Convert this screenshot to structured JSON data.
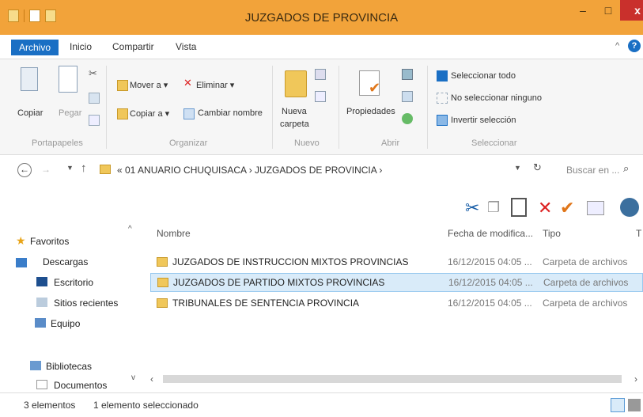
{
  "window": {
    "title": "JUZGADOS DE PROVINCIA",
    "minimize": "–",
    "maximize": "□",
    "close": "x"
  },
  "tabs": [
    {
      "label": "Archivo"
    },
    {
      "label": "Inicio"
    },
    {
      "label": "Compartir"
    },
    {
      "label": "Vista"
    }
  ],
  "ribbon": {
    "portapapeles": {
      "label": "Portapapeles",
      "copiar": "Copiar",
      "pegar": "Pegar"
    },
    "organizar": {
      "label": "Organizar",
      "mover_a": "Mover a ▾",
      "copiar_a": "Copiar a ▾",
      "eliminar": "Eliminar ▾",
      "cambiar_nombre": "Cambiar nombre"
    },
    "nuevo": {
      "label": "Nuevo",
      "nueva_carpeta_1": "Nueva",
      "nueva_carpeta_2": "carpeta"
    },
    "abrir": {
      "label": "Abrir",
      "propiedades": "Propiedades"
    },
    "seleccionar": {
      "label": "Seleccionar",
      "todo": "Seleccionar todo",
      "ninguno": "No seleccionar ninguno",
      "invertir": "Invertir selección"
    }
  },
  "address": {
    "crumbs": "« 01 ANUARIO CHUQUISACA  ›  JUZGADOS DE PROVINCIA  ›",
    "search_placeholder": "Buscar en ..."
  },
  "nav": {
    "favoritos": "Favoritos",
    "descargas": "Descargas",
    "escritorio": "Escritorio",
    "sitios_recientes": "Sitios recientes",
    "equipo": "Equipo",
    "bibliotecas": "Bibliotecas",
    "documentos": "Documentos"
  },
  "columns": {
    "nombre": "Nombre",
    "fecha": "Fecha de modifica...",
    "tipo": "Tipo",
    "extra": "T"
  },
  "files": [
    {
      "name": "JUZGADOS DE INSTRUCCION MIXTOS PROVINCIAS",
      "date": "16/12/2015 04:05 ...",
      "type": "Carpeta de archivos"
    },
    {
      "name": "JUZGADOS DE PARTIDO MIXTOS PROVINCIAS",
      "date": "16/12/2015 04:05 ...",
      "type": "Carpeta de archivos"
    },
    {
      "name": "TRIBUNALES DE SENTENCIA PROVINCIA",
      "date": "16/12/2015 04:05 ...",
      "type": "Carpeta de archivos"
    }
  ],
  "status": {
    "count": "3 elementos",
    "selected": "1 elemento seleccionado"
  }
}
